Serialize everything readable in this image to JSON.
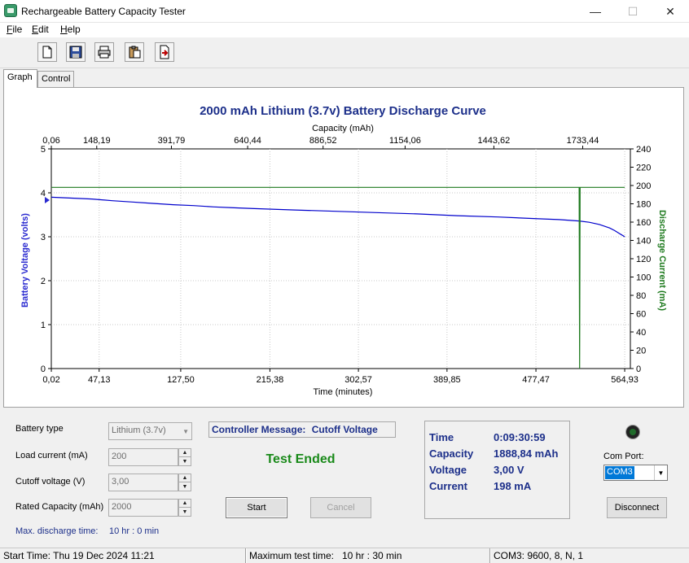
{
  "window": {
    "title": "Rechargeable Battery Capacity Tester",
    "controls": {
      "minimize": "—",
      "maximize": "☐",
      "close": "✕"
    }
  },
  "menu": [
    {
      "label": "File",
      "key": "F",
      "rest": "ile"
    },
    {
      "label": "Edit",
      "key": "E",
      "rest": "dit"
    },
    {
      "label": "Help",
      "key": "H",
      "rest": "elp"
    }
  ],
  "toolbar": {
    "buttons": [
      {
        "name": "new-document-icon"
      },
      {
        "name": "save-icon"
      },
      {
        "name": "print-icon"
      },
      {
        "name": "paste-icon"
      },
      {
        "name": "export-icon"
      }
    ]
  },
  "tabs": [
    {
      "label": "Graph",
      "active": true
    },
    {
      "label": "Control",
      "active": false
    }
  ],
  "chart_data": {
    "type": "line",
    "title": "2000 mAh Lithium (3.7v) Battery Discharge Curve",
    "xlabel": "Time (minutes)",
    "x2label": "Capacity (mAh)",
    "ylabel": "Battery Voltage (volts)",
    "y2label": "Discharge Current (mA)",
    "x_ticks": [
      "0,02",
      "47,13",
      "127,50",
      "215,38",
      "302,57",
      "389,85",
      "477,47",
      "564,93"
    ],
    "x_tick_values": [
      0.02,
      47.13,
      127.5,
      215.38,
      302.57,
      389.85,
      477.47,
      564.93
    ],
    "x2_ticks": [
      "0,06",
      "148,19",
      "391,79",
      "640,44",
      "886,52",
      "1154,06",
      "1443,62",
      "1733,44"
    ],
    "x2_tick_values": [
      0.06,
      148.19,
      391.79,
      640.44,
      886.52,
      1154.06,
      1443.62,
      1733.44
    ],
    "xlim": [
      0,
      570.5
    ],
    "x2lim": [
      0,
      1888.84
    ],
    "y_ticks": [
      "0",
      "1",
      "2",
      "3",
      "4",
      "5"
    ],
    "ylim": [
      0,
      5
    ],
    "y2_ticks": [
      "0",
      "20",
      "40",
      "60",
      "80",
      "100",
      "120",
      "140",
      "160",
      "180",
      "200",
      "220",
      "240"
    ],
    "y2lim": [
      0,
      240
    ],
    "grid": true,
    "series": [
      {
        "name": "Battery Voltage (volts)",
        "axis": "left",
        "color": "#0000cc",
        "x": [
          0.02,
          20,
          40,
          60,
          80,
          100,
          120,
          140,
          160,
          180,
          200,
          240,
          280,
          320,
          360,
          400,
          440,
          480,
          500,
          520,
          530,
          540,
          550,
          555,
          560,
          564.93
        ],
        "y": [
          3.9,
          3.88,
          3.86,
          3.82,
          3.79,
          3.76,
          3.73,
          3.71,
          3.68,
          3.66,
          3.64,
          3.61,
          3.58,
          3.55,
          3.52,
          3.48,
          3.45,
          3.41,
          3.39,
          3.36,
          3.33,
          3.28,
          3.2,
          3.14,
          3.07,
          3.0
        ]
      },
      {
        "name": "Discharge Current (mA)",
        "axis": "right",
        "color": "#1e7a1e",
        "x": [
          0.02,
          100,
          200,
          300,
          400,
          500,
          520,
          520.5,
          521,
          540,
          564.93
        ],
        "y": [
          198,
          198,
          198,
          198,
          198,
          198,
          198,
          0,
          198,
          198,
          198
        ]
      }
    ]
  },
  "settings": {
    "battery_type": {
      "label": "Battery type",
      "value": "Lithium (3.7v)"
    },
    "load_current": {
      "label": "Load current (mA)",
      "value": "200"
    },
    "cutoff_voltage": {
      "label": "Cutoff voltage (V)",
      "value": "3,00"
    },
    "rated_capacity": {
      "label": "Rated Capacity (mAh)",
      "value": "2000"
    },
    "max_discharge": {
      "label": "Max. discharge time:",
      "value": "10 hr : 0 min"
    }
  },
  "controller": {
    "label": "Controller Message:",
    "message": "Cutoff Voltage",
    "status": "Test Ended",
    "status_color": "#1a8a1a"
  },
  "buttons": {
    "start": "Start",
    "cancel": "Cancel",
    "disconnect": "Disconnect"
  },
  "readout": {
    "time": {
      "label": "Time",
      "value": "0:09:30:59"
    },
    "capacity": {
      "label": "Capacity",
      "value": "1888,84 mAh"
    },
    "voltage": {
      "label": "Voltage",
      "value": "3,00 V"
    },
    "current": {
      "label": "Current",
      "value": "198 mA"
    }
  },
  "com": {
    "label": "Com Port:",
    "value": "COM3",
    "indicator_color": "#1f6b2a"
  },
  "status_bar": {
    "start_time": "Start Time: Thu 19 Dec 2024 11:21",
    "max_test_label": "Maximum test time:",
    "max_test_value": "10 hr : 30 min",
    "port_info": "COM3: 9600, 8, N, 1"
  }
}
